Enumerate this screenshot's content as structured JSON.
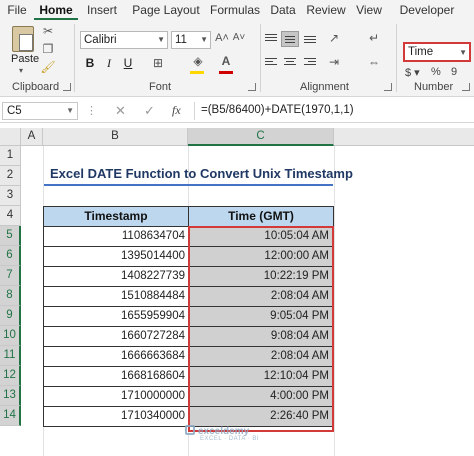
{
  "ribbon_tabs": [
    {
      "label": "File",
      "active": false
    },
    {
      "label": "Home",
      "active": true
    },
    {
      "label": "Insert",
      "active": false
    },
    {
      "label": "Page Layout",
      "active": false
    },
    {
      "label": "Formulas",
      "active": false
    },
    {
      "label": "Data",
      "active": false
    },
    {
      "label": "Review",
      "active": false
    },
    {
      "label": "View",
      "active": false
    },
    {
      "label": "Developer",
      "active": false
    }
  ],
  "ribbon": {
    "clipboard": {
      "paste_label": "Paste",
      "group_label": "Clipboard"
    },
    "font": {
      "name": "Calibri",
      "size": "11",
      "group_label": "Font",
      "bold": "B",
      "italic": "I",
      "underline": "U",
      "fill_color": "#ffd700",
      "font_color": "#d00000"
    },
    "alignment": {
      "group_label": "Alignment"
    },
    "number": {
      "format": "Time",
      "group_label": "Number"
    }
  },
  "formula_bar": {
    "name_box": "C5",
    "fx_label": "fx",
    "formula": "=(B5/86400)+DATE(1970,1,1)"
  },
  "columns": [
    "A",
    "B",
    "C"
  ],
  "rows": [
    "1",
    "2",
    "3",
    "4",
    "5",
    "6",
    "7",
    "8",
    "9",
    "10",
    "11",
    "12",
    "13",
    "14"
  ],
  "sheet": {
    "title": "Excel DATE Function to Convert Unix Timestamp",
    "headers": {
      "timestamp": "Timestamp",
      "time": "Time (GMT)"
    },
    "data": [
      {
        "timestamp": "1108634704",
        "time": "10:05:04 AM"
      },
      {
        "timestamp": "1395014400",
        "time": "12:00:00 AM"
      },
      {
        "timestamp": "1408227739",
        "time": "10:22:19 PM"
      },
      {
        "timestamp": "1510884484",
        "time": "2:08:04 AM"
      },
      {
        "timestamp": "1655959904",
        "time": "9:05:04 PM"
      },
      {
        "timestamp": "1660727284",
        "time": "9:08:04 AM"
      },
      {
        "timestamp": "1666663684",
        "time": "2:08:04 AM"
      },
      {
        "timestamp": "1668168604",
        "time": "12:10:04 PM"
      },
      {
        "timestamp": "1710000000",
        "time": "4:00:00 PM"
      },
      {
        "timestamp": "1710340000",
        "time": "2:26:40 PM"
      }
    ]
  },
  "watermark": {
    "brand": "exceldemy",
    "tagline": "EXCEL · DATA · BI"
  },
  "colors": {
    "accent": "#217346",
    "header_fill": "#bdd7ee",
    "selection_border": "#d23a3a",
    "time_fill": "#d0d0d0"
  }
}
